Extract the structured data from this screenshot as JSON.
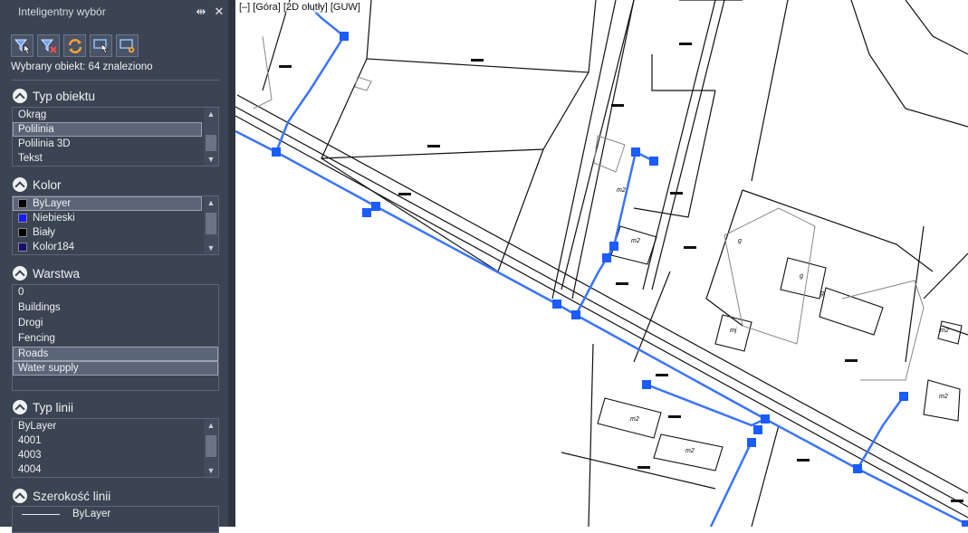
{
  "panel": {
    "title": "Inteligentny wybór",
    "pin_glyph": "⇹",
    "close_glyph": "✕",
    "toolbar": [
      {
        "icon": "filter-select-icon"
      },
      {
        "icon": "filter-clear-icon"
      },
      {
        "icon": "refresh-icon"
      },
      {
        "icon": "select-window-icon"
      },
      {
        "icon": "settings-select-icon"
      }
    ],
    "found_text": "Wybrany obiekt: 64 znaleziono",
    "sections": {
      "object_type": {
        "title": "Typ obiektu",
        "items": [
          "Okrąg",
          "Polilinia",
          "Polilinia 3D",
          "Tekst"
        ]
      },
      "color": {
        "title": "Kolor",
        "items": [
          {
            "label": "ByLayer",
            "color": "#000000"
          },
          {
            "label": "Niebieski",
            "color": "#1a1aff"
          },
          {
            "label": "Biały",
            "color": "#000000"
          },
          {
            "label": "Kolor184",
            "color": "#1a0f6e"
          }
        ]
      },
      "layer": {
        "title": "Warstwa",
        "items": [
          "0",
          "Buildings",
          "Drogi",
          "Fencing",
          "Roads",
          "Water supply"
        ]
      },
      "linetype": {
        "title": "Typ linii",
        "items": [
          "ByLayer",
          "4001",
          "4003",
          "4004"
        ]
      },
      "lineweight": {
        "title": "Szerokość linii",
        "items": [
          "ByLayer"
        ]
      }
    }
  },
  "viewport": {
    "label": "[–] [Góra] [2D olutły] [GUW]",
    "accent": "#1a5cff",
    "building_labels": [
      "m2",
      "m2",
      "m2",
      "m2",
      "m2",
      "g",
      "g",
      "g",
      "mj",
      "m2"
    ]
  }
}
